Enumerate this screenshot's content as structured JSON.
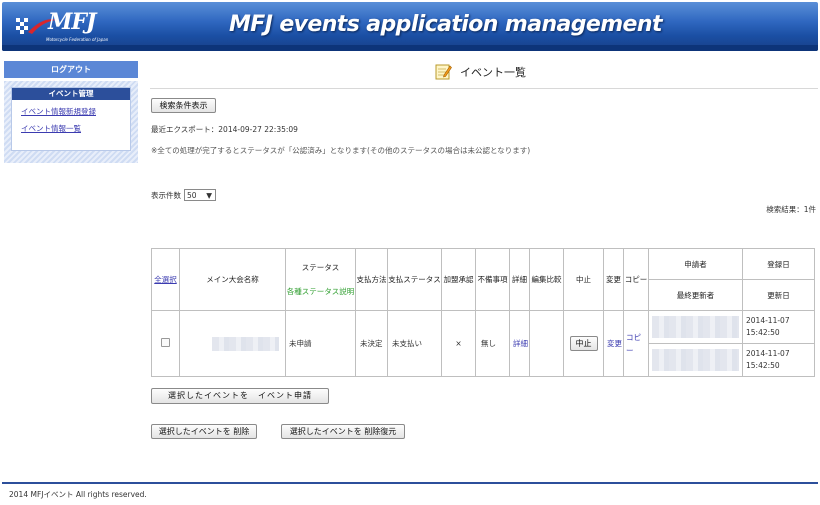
{
  "header": {
    "logo_text": "MFJ",
    "logo_subtitle": "Motorcycle Federation of Japan",
    "app_title": "MFJ events application management"
  },
  "sidebar": {
    "logout_label": "ログアウト",
    "section_title": "イベント管理",
    "links": [
      "イベント情報新規登録",
      "イベント情報一覧"
    ]
  },
  "page": {
    "title": "イベント一覧",
    "search_button": "検索条件表示",
    "last_export": "最近エクスポート：2014-09-27 22:35:09",
    "note": "※全ての処理が完了するとステータスが「公認済み」となります(その他のステータスの場合は未公認となります)",
    "per_page_label": "表示件数",
    "per_page_value": "50",
    "result_count": "検索結果：1件"
  },
  "table": {
    "headers": {
      "select_all": "全選択",
      "main_event": "メイン大会名称",
      "status": "ステータス",
      "status_help": "各種ステータス説明",
      "payment_method": "支払方法",
      "payment_status": "支払ステータス",
      "affiliation": "加盟承認",
      "defect": "不備事項",
      "detail": "詳細",
      "edit_compare": "編集比較",
      "cancel": "中止",
      "change": "変更",
      "copy": "コピー",
      "applicant": "申請者",
      "last_updater": "最終更新者",
      "registered_date": "登録日",
      "updated_date": "更新日"
    },
    "row": {
      "status": "未申請",
      "payment_method": "未決定",
      "payment_status": "未支払い",
      "affiliation": "×",
      "defect": "無し",
      "detail_link": "詳細",
      "cancel_button": "中止",
      "change_link": "変更",
      "copy_link": "コピー",
      "registered_date": "2014-11-07",
      "registered_time": "15:42:50",
      "updated_date": "2014-11-07",
      "updated_time": "15:42:50"
    }
  },
  "actions": {
    "apply": "選択したイベントを　イベント申請",
    "delete": "選択したイベントを 削除",
    "restore": "選択したイベントを 削除復元"
  },
  "footer": {
    "copyright": "2014 MFJイベント All rights reserved."
  },
  "colors": {
    "header_blue": "#1a4ea3",
    "sidebar_blue": "#5b87d6",
    "link": "#3b3bb0",
    "status_help_green": "#2e9e2e"
  }
}
